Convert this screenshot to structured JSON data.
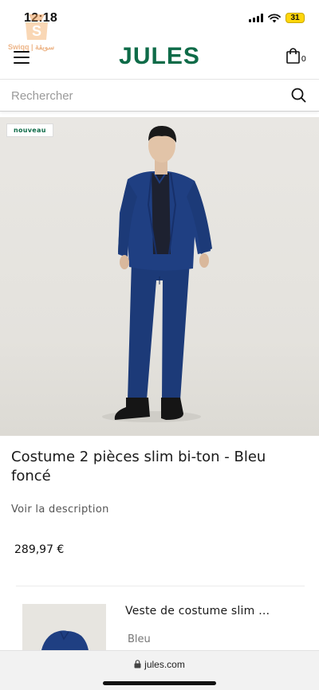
{
  "status_bar": {
    "time": "12:18",
    "battery": "31"
  },
  "watermark": {
    "text": "Swiqq | سويقة"
  },
  "header": {
    "logo": "JULES",
    "cart_count": "0"
  },
  "search": {
    "placeholder": "Rechercher",
    "value": ""
  },
  "product": {
    "badge": "nouveau",
    "title": "Costume 2 pièces slim bi-ton - Bleu foncé",
    "description_link": "Voir la description",
    "price": "289,97 €"
  },
  "set_item": {
    "name": "Veste de costume slim …",
    "color": "Bleu"
  },
  "browser": {
    "url": "jules.com"
  },
  "colors": {
    "brand_green": "#0e6b48",
    "suit_navy": "#1c3a78"
  }
}
